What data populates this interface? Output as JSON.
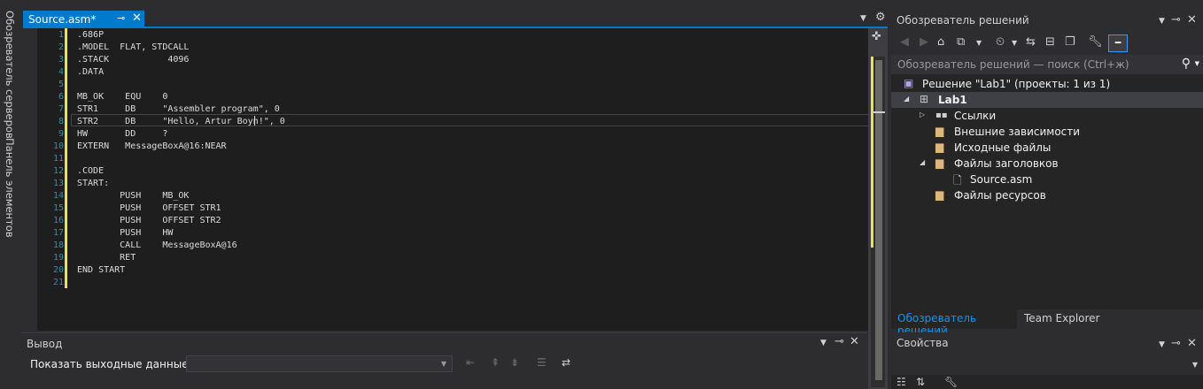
{
  "side_strip": {
    "tab1": "Обозреватель серверов",
    "tab2": "Панель элементов"
  },
  "editor": {
    "tab_title": "Source.asm*",
    "pin_icon": "⊸",
    "close_icon": "✕",
    "line_numbers": [
      "1",
      "2",
      "3",
      "4",
      "5",
      "6",
      "7",
      "8",
      "9",
      "10",
      "11",
      "12",
      "13",
      "14",
      "15",
      "16",
      "17",
      "18",
      "19",
      "20",
      "21"
    ],
    "lines": [
      ".686P",
      ".MODEL  FLAT, STDCALL",
      ".STACK           4096",
      ".DATA",
      "",
      "MB_OK    EQU    0",
      "STR1     DB     \"Assembler program\", 0",
      "STR2     DB     \"Hello, Artur Boyn!\", 0",
      "HW       DD     ?",
      "EXTERN   MessageBoxA@16:NEAR",
      "",
      ".CODE",
      "START:",
      "        PUSH    MB_OK",
      "        PUSH    OFFSET STR1",
      "        PUSH    OFFSET STR2",
      "        PUSH    HW",
      "        CALL    MessageBoxA@16",
      "        RET",
      "END START",
      ""
    ],
    "colors": {
      "gutter": "#2b91af",
      "changebar": "#e5e54c",
      "accent": "#007acc"
    }
  },
  "output": {
    "title": "Вывод",
    "show_output_from_label": "Показать выходные данные из:",
    "source_value": ""
  },
  "solution_explorer": {
    "title": "Обозреватель решений",
    "search_placeholder": "Обозреватель решений — поиск (Ctrl+ж)",
    "tree": {
      "solution": "Решение \"Lab1\" (проекты: 1 из 1)",
      "project": "Lab1",
      "references": "Ссылки",
      "external_deps": "Внешние зависимости",
      "source_files": "Исходные файлы",
      "header_files": "Файлы заголовков",
      "source_asm": "Source.asm",
      "resource_files": "Файлы ресурсов"
    },
    "tabs": {
      "solution_explorer": "Обозреватель решений",
      "team_explorer": "Team Explorer"
    }
  },
  "properties": {
    "title": "Свойства"
  }
}
